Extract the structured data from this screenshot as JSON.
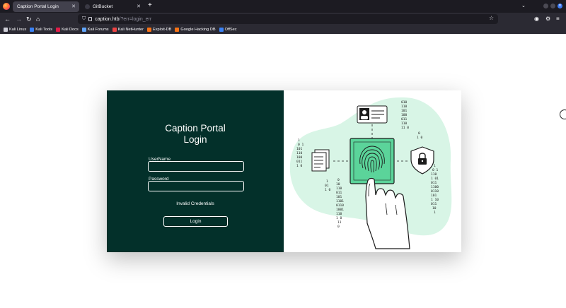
{
  "browser": {
    "tabs": [
      {
        "label": "Caption Portal Login",
        "active": true
      },
      {
        "label": "GitBucket",
        "active": false
      }
    ],
    "url": {
      "host": "caption.htb",
      "path": "/?err=login_err"
    },
    "bookmarks": [
      {
        "label": "Kali Linux",
        "color": "#cfcfd8"
      },
      {
        "label": "Kali Tools",
        "color": "#3b82f6"
      },
      {
        "label": "Kali Docs",
        "color": "#e11d48"
      },
      {
        "label": "Kali Forums",
        "color": "#60a5fa"
      },
      {
        "label": "Kali NetHunter",
        "color": "#ef4444"
      },
      {
        "label": "Exploit-DB",
        "color": "#f97316"
      },
      {
        "label": "Google Hacking DB",
        "color": "#f97316"
      },
      {
        "label": "OffSec",
        "color": "#3b82f6"
      }
    ]
  },
  "login": {
    "title_line1": "Caption Portal",
    "title_line2": "Login",
    "username_label": "UserName",
    "password_label": "Password",
    "error": "Invalid Credentials",
    "button": "Login"
  },
  "colors": {
    "panel_bg": "#03302a",
    "illustration_blob": "#d8f5e6",
    "illustration_accent": "#5bd49a"
  }
}
